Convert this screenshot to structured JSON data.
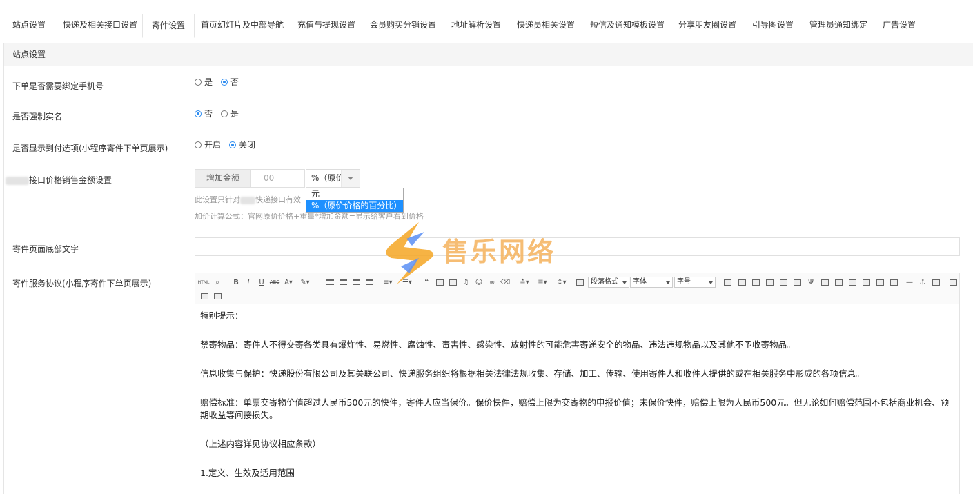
{
  "tabs": [
    {
      "label": "站点设置"
    },
    {
      "label": "快递及相关接口设置"
    },
    {
      "label": "寄件设置",
      "active": true
    },
    {
      "label": "首页幻灯片及中部导航"
    },
    {
      "label": "充值与提现设置"
    },
    {
      "label": "会员购买分销设置"
    },
    {
      "label": "地址解析设置"
    },
    {
      "label": "快递员相关设置"
    },
    {
      "label": "短信及通知模板设置"
    },
    {
      "label": "分享朋友圈设置"
    },
    {
      "label": "引导图设置"
    },
    {
      "label": "管理员通知绑定"
    },
    {
      "label": "广告设置"
    }
  ],
  "panel": {
    "title": "站点设置"
  },
  "rows": {
    "bind_phone": {
      "label": "下单是否需要绑定手机号",
      "options": [
        "是",
        "否"
      ],
      "selected": "否"
    },
    "real_name": {
      "label": "是否强制实名",
      "options": [
        "否",
        "是"
      ],
      "selected": "否"
    },
    "cod": {
      "label": "是否显示到付选项(小程序寄件下单页展示)",
      "options": [
        "开启",
        "关闭"
      ],
      "selected": "关闭"
    },
    "price": {
      "label": "接口价格销售金额设置",
      "addon": "增加金额",
      "amount": "00",
      "select_value": "%（原价",
      "options": [
        "元",
        "%（原价价格的百分比）"
      ],
      "selected_option": "%（原价价格的百分比）",
      "hint1_pre": "此设置只针对",
      "hint1_post": "快递接口有效",
      "hint2": "加价计算公式：官网原价价格+重量*增加金额=显示给客户看到价格"
    },
    "footer_text": {
      "label": "寄件页面底部文字",
      "value": ""
    },
    "agreement": {
      "label": "寄件服务协议(小程序寄件下单页展示)",
      "toolbar": {
        "para_format": "段落格式",
        "font_family": "字体",
        "font_size": "字号"
      },
      "content": [
        "特别提示：",
        "禁寄物品：寄件人不得交寄各类具有爆炸性、易燃性、腐蚀性、毒害性、感染性、放射性的可能危害寄递安全的物品、违法违规物品以及其他不予收寄物品。",
        "信息收集与保护：快递股份有限公司及其关联公司、快递服务组织将根据相关法律法规收集、存储、加工、传输、使用寄件人和收件人提供的或在相关服务中形成的各项信息。",
        "赔偿标准：单票交寄物价值超过人民币500元的快件，寄件人应当保价。保价快件，赔偿上限为交寄物的申报价值；未保价快件，赔偿上限为人民币500元。但无论如何赔偿范围不包括商业机会、预期收益等间接损失。",
        "（上述内容详见协议相应条款）",
        "1.定义、生效及适用范围"
      ]
    }
  },
  "watermark": {
    "text": "售乐网络",
    "colors": {
      "orange": "#f5a623",
      "blue": "#5b8ff5"
    }
  },
  "colors": {
    "accent": "#2d8cf0",
    "dropdown_selected": "#1e90ff"
  }
}
